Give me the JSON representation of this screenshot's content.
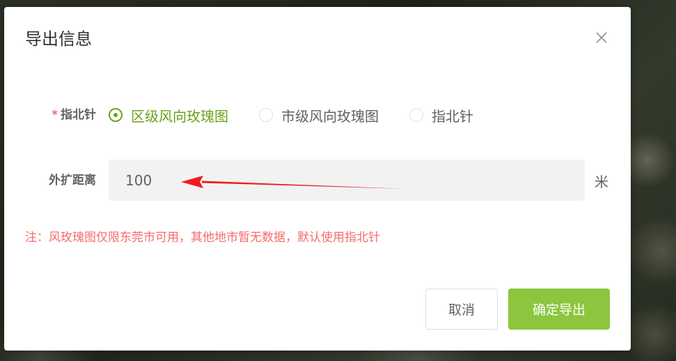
{
  "dialog": {
    "title": "导出信息",
    "close_icon": "close-icon"
  },
  "form": {
    "type_field": {
      "required_mark": "*",
      "label": "指北针",
      "options": [
        {
          "label": "区级风向玫瑰图",
          "checked": true
        },
        {
          "label": "市级风向玫瑰图",
          "checked": false
        },
        {
          "label": "指北针",
          "checked": false
        }
      ]
    },
    "distance_field": {
      "label": "外扩距离",
      "value": "100",
      "unit": "米"
    },
    "note": "注：风玫瑰图仅限东莞市可用，其他地市暂无数据，默认使用指北针"
  },
  "footer": {
    "cancel_label": "取消",
    "confirm_label": "确定导出"
  },
  "colors": {
    "accent": "#6aa318",
    "confirm_button": "#8cc63f",
    "warning": "#f56c6c",
    "annotation_arrow": "#ee1c1c"
  }
}
